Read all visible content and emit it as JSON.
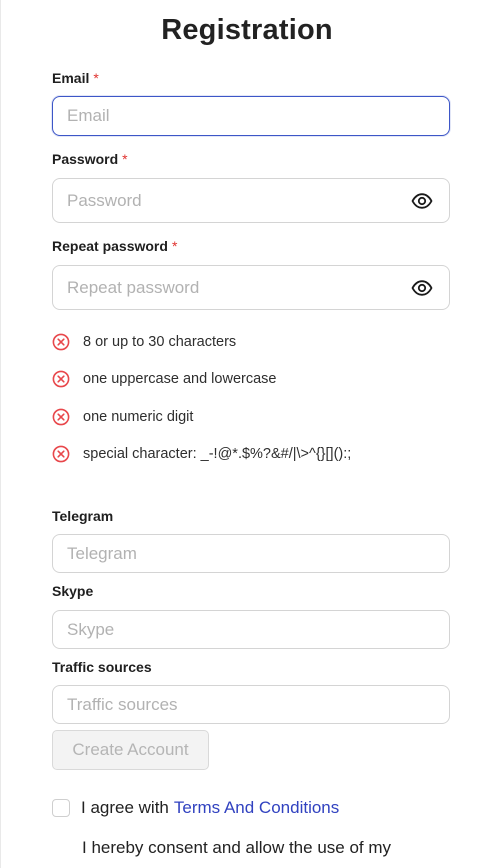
{
  "title": "Registration",
  "required_mark": "*",
  "email": {
    "label": "Email",
    "placeholder": "Email",
    "value": ""
  },
  "password": {
    "label": "Password",
    "placeholder": "Password",
    "value": ""
  },
  "repeat_password": {
    "label": "Repeat password",
    "placeholder": "Repeat password",
    "value": ""
  },
  "requirements": [
    {
      "text": "8 or up to 30 characters",
      "met": false
    },
    {
      "text": "one uppercase and lowercase",
      "met": false
    },
    {
      "text": "one numeric digit",
      "met": false
    },
    {
      "text": "special character: _-!@*.$%?&#/|\\>^{}[]():;",
      "met": false
    }
  ],
  "telegram": {
    "label": "Telegram",
    "placeholder": "Telegram",
    "value": ""
  },
  "skype": {
    "label": "Skype",
    "placeholder": "Skype",
    "value": ""
  },
  "traffic_sources": {
    "label": "Traffic sources",
    "placeholder": "Traffic sources",
    "value": ""
  },
  "create_account_label": "Create Account",
  "agree": {
    "prefix": "I agree with",
    "link": "Terms And Conditions",
    "checked": false
  },
  "consent_text": "I hereby consent and allow the use of my",
  "colors": {
    "required": "#e0322f",
    "focus_border": "#3d56c7",
    "link": "#3142c0",
    "error_icon": "#e8474b"
  },
  "icons": {
    "show_password": "eye-icon",
    "requirement_unmet": "circle-x-icon"
  }
}
